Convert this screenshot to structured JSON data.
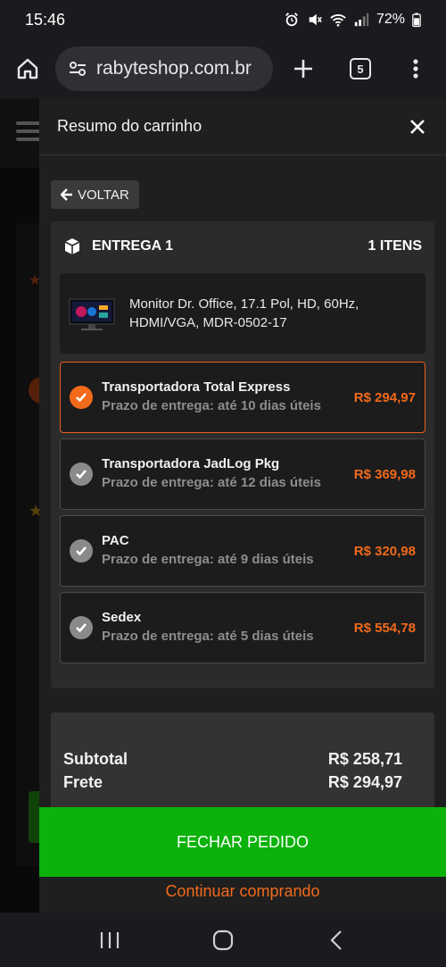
{
  "status": {
    "time": "15:46",
    "battery": "72%"
  },
  "browser": {
    "url": "rabyteshop.com.br",
    "tab_count": "5"
  },
  "drawer": {
    "title": "Resumo do carrinho",
    "back_label": "VOLTAR",
    "delivery": {
      "label": "ENTREGA 1",
      "count": "1 ITENS",
      "product_name": "Monitor Dr. Office, 17.1 Pol, HD, 60Hz, HDMI/VGA, MDR-0502-17",
      "options": [
        {
          "name": "Transportadora Total Express",
          "prazo": "Prazo de entrega: até 10 dias úteis",
          "price": "R$ 294,97",
          "selected": true
        },
        {
          "name": "Transportadora JadLog Pkg",
          "prazo": "Prazo de entrega: até 12 dias úteis",
          "price": "R$ 369,98",
          "selected": false
        },
        {
          "name": "PAC",
          "prazo": "Prazo de entrega: até 9 dias úteis",
          "price": "R$ 320,98",
          "selected": false
        },
        {
          "name": "Sedex",
          "prazo": "Prazo de entrega: até 5 dias úteis",
          "price": "R$ 554,78",
          "selected": false
        }
      ]
    },
    "summary": {
      "subtotal_label": "Subtotal",
      "subtotal_value": "R$ 258,71",
      "frete_label": "Frete",
      "frete_value": "R$ 294,97"
    },
    "checkout_label": "FECHAR PEDIDO",
    "continue_label": "Continuar comprando"
  },
  "colors": {
    "accent": "#f26a1b",
    "checkout": "#0ab20a"
  }
}
